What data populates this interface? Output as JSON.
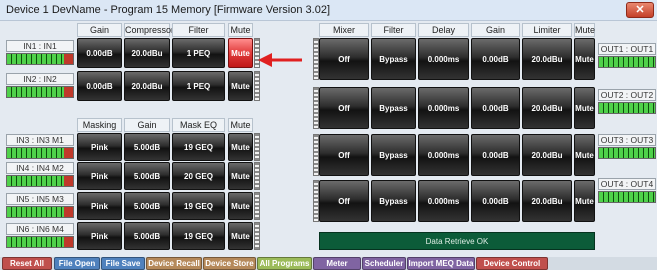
{
  "window": {
    "title": "Device 1 DevName  -  Program 15  Memory [Firmware Version 3.02]",
    "close_glyph": "✕"
  },
  "input_headers": [
    "Gain",
    "Compressor",
    "Filter",
    "Mute"
  ],
  "input_headers2": [
    "Masking",
    "Gain",
    "Mask EQ",
    "Mute"
  ],
  "output_headers": [
    "Mixer",
    "Filter",
    "Delay",
    "Gain",
    "Limiter",
    "Mute"
  ],
  "inputs": [
    {
      "label": "IN1 : IN1",
      "gain": "0.00dB",
      "compressor": "20.0dBu",
      "filter": "1 PEQ",
      "mute": "Mute",
      "mute_active": true
    },
    {
      "label": "IN2 : IN2",
      "gain": "0.00dB",
      "compressor": "20.0dBu",
      "filter": "1 PEQ",
      "mute": "Mute",
      "mute_active": false
    }
  ],
  "mask_inputs": [
    {
      "label": "IN3 : IN3 M1",
      "masking": "Pink",
      "gain": "5.00dB",
      "mask_eq": "19 GEQ",
      "mute": "Mute"
    },
    {
      "label": "IN4 : IN4 M2",
      "masking": "Pink",
      "gain": "5.00dB",
      "mask_eq": "20 GEQ",
      "mute": "Mute"
    },
    {
      "label": "IN5 : IN5 M3",
      "masking": "Pink",
      "gain": "5.00dB",
      "mask_eq": "19 GEQ",
      "mute": "Mute"
    },
    {
      "label": "IN6 : IN6 M4",
      "masking": "Pink",
      "gain": "5.00dB",
      "mask_eq": "19 GEQ",
      "mute": "Mute"
    }
  ],
  "outputs": [
    {
      "label": "OUT1 : OUT1",
      "mixer": "Off",
      "filter": "Bypass",
      "delay": "0.000ms",
      "gain": "0.00dB",
      "limiter": "20.0dBu",
      "mute": "Mute"
    },
    {
      "label": "OUT2 : OUT2",
      "mixer": "Off",
      "filter": "Bypass",
      "delay": "0.000ms",
      "gain": "0.00dB",
      "limiter": "20.0dBu",
      "mute": "Mute"
    },
    {
      "label": "OUT3 : OUT3",
      "mixer": "Off",
      "filter": "Bypass",
      "delay": "0.000ms",
      "gain": "0.00dB",
      "limiter": "20.0dBu",
      "mute": "Mute"
    },
    {
      "label": "OUT4 : OUT4",
      "mixer": "Off",
      "filter": "Bypass",
      "delay": "0.000ms",
      "gain": "0.00dB",
      "limiter": "20.0dBu",
      "mute": "Mute"
    }
  ],
  "status": "Data Retrieve OK",
  "toolbar": [
    {
      "label": "Reset All",
      "color": "#c0504d"
    },
    {
      "label": "File Open",
      "color": "#4f81bd"
    },
    {
      "label": "File Save",
      "color": "#4f81bd"
    },
    {
      "label": "Device Recall",
      "color": "#b5895a"
    },
    {
      "label": "Device Store",
      "color": "#b5895a"
    },
    {
      "label": "All Programs",
      "color": "#9bbb59"
    },
    {
      "label": "Meter",
      "color": "#8064a2"
    },
    {
      "label": "Scheduler",
      "color": "#8064a2"
    },
    {
      "label": "Import MEQ Data",
      "color": "#8064a2"
    },
    {
      "label": "Device Control",
      "color": "#c0504d"
    }
  ],
  "colors": {
    "mute_active": "#e03a3a",
    "status_bg": "#0c5c39",
    "arrow": "#e02020"
  }
}
